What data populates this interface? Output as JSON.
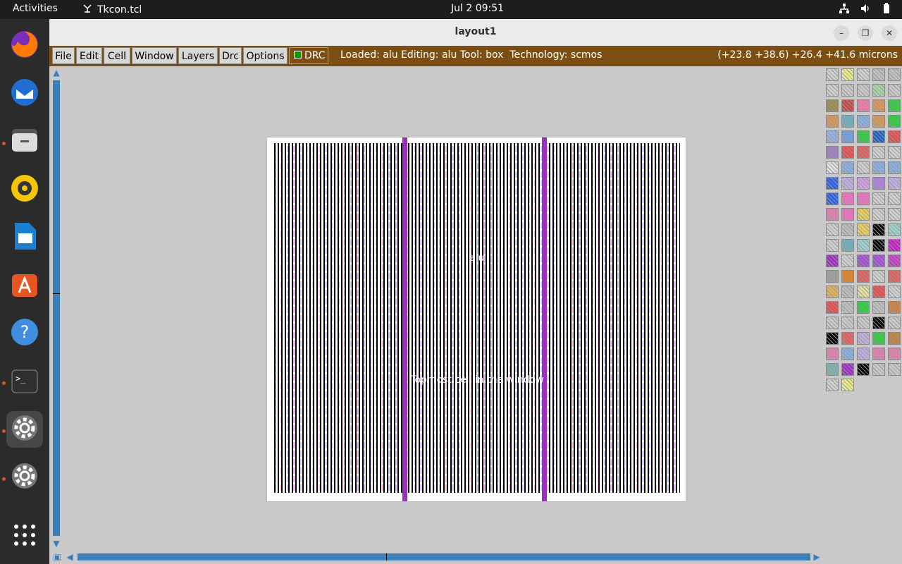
{
  "topbar": {
    "activities": "Activities",
    "app_name": "Tkcon.tcl",
    "clock": "Jul 2  09:51"
  },
  "dock": {
    "items": [
      {
        "name": "firefox",
        "color": "#e66000"
      },
      {
        "name": "thunderbird",
        "color": "#1f6fd1"
      },
      {
        "name": "files",
        "color": "#ddd"
      },
      {
        "name": "rhythmbox",
        "color": "#f7c600"
      },
      {
        "name": "writer",
        "color": "#1a7fd1"
      },
      {
        "name": "app-center",
        "color": "#e95420"
      },
      {
        "name": "help",
        "color": "#3f8ee0"
      },
      {
        "name": "terminal",
        "color": "#3a3a3a"
      },
      {
        "name": "settings",
        "color": "#777"
      },
      {
        "name": "settings-2",
        "color": "#777"
      },
      {
        "name": "show-apps",
        "color": "#fff"
      }
    ]
  },
  "window": {
    "title": "layout1"
  },
  "menubar": {
    "items": [
      "File",
      "Edit",
      "Cell",
      "Window",
      "Layers",
      "Drc",
      "Options"
    ],
    "drc_label": "DRC",
    "status": "Loaded: alu Editing: alu Tool: box  Technology: scmos",
    "coords": "(+23.8 +38.6) +26.4 +41.6 microns"
  },
  "canvas": {
    "cell_name": "alu",
    "top_label": "Topmost cell in the window"
  },
  "palette": {
    "rows": [
      [
        "#cfcfcf",
        "#eaea90",
        "#d0d0d0",
        "#c0c0c0",
        "#c0c0c0"
      ],
      [
        "#cfcfcf",
        "#c9c9c9",
        "#c9c9c9",
        "#a6d6a6",
        "#c9c9c9"
      ],
      [
        "#9b8a4f",
        "#c24a4a",
        "#f07aa8",
        "#d8985a",
        "#2ecc40"
      ],
      [
        "#d8985a",
        "#6fb0c0",
        "#8ab0e0",
        "#d8985a",
        "#2ecc40"
      ],
      [
        "#9ab0e0",
        "#6fa0e0",
        "#2ecc40",
        "#2060c0",
        "#e05050"
      ],
      [
        "#9a80c0",
        "#e05050",
        "#e06060",
        "#cfcfcf",
        "#cfcfcf"
      ],
      [
        "#e0e0e0",
        "#8ab0e0",
        "#cfcfcf",
        "#8ab0e0",
        "#8ab0e0"
      ],
      [
        "#3060e0",
        "#c0b0e0",
        "#d0a0e0",
        "#b080e0",
        "#c0b0e0"
      ],
      [
        "#3060e0",
        "#f070c0",
        "#f070c0",
        "#cfcfcf",
        "#cfcfcf"
      ],
      [
        "#e080b0",
        "#f070c0",
        "#e8d060",
        "#cfcfcf",
        "#cfcfcf"
      ],
      [
        "#cfcfcf",
        "#bdbdbd",
        "#e8d060",
        "#000000",
        "#a0d0d0"
      ],
      [
        "#cfcfcf",
        "#6fb0c0",
        "#a0d0d0",
        "#000000",
        "#c020c0"
      ],
      [
        "#9b30c0",
        "#cfcfcf",
        "#a050d0",
        "#a050d0",
        "#c040c0"
      ],
      [
        "#a0a0a0",
        "#e08020",
        "#e06060",
        "#cfcfcf",
        "#e06060"
      ],
      [
        "#e0b060",
        "#bdbdbd",
        "#e0e0a0",
        "#e05050",
        "#cfcfcf"
      ],
      [
        "#e05050",
        "#c0c0c0",
        "#2ecc40",
        "#c0c0c0",
        "#d08040"
      ],
      [
        "#c9c9c9",
        "#c9c9c9",
        "#c9c9c9",
        "#000000",
        "#c9c9c9"
      ],
      [
        "#000000",
        "#e06060",
        "#c0b0e0",
        "#2ecc40",
        "#c08040"
      ],
      [
        "#e080b0",
        "#8ab0e0",
        "#c0b0e0",
        "#e080b0",
        "#e080b0"
      ],
      [
        "#80b0b0",
        "#9b30c0",
        "#000000",
        "#c9c9c9",
        "#c9c9c9"
      ],
      [
        "#cfcfcf",
        "#eaea90"
      ]
    ]
  }
}
